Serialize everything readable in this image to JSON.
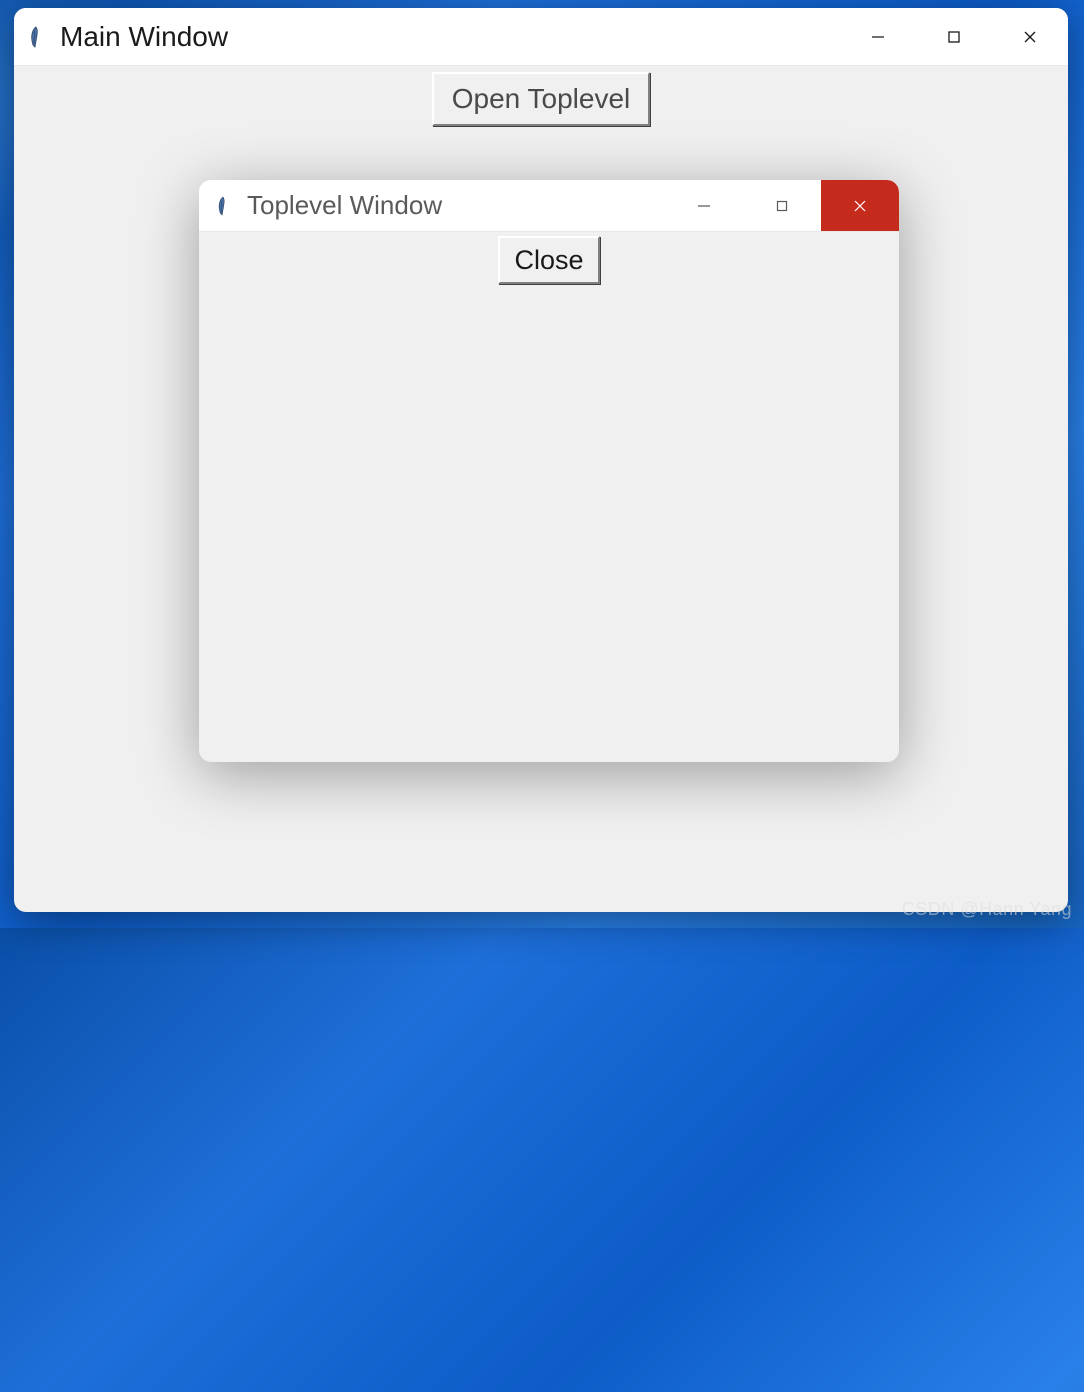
{
  "main_window": {
    "title": "Main Window",
    "open_button_label": "Open Toplevel"
  },
  "toplevel_window": {
    "title": "Toplevel Window",
    "close_button_label": "Close"
  },
  "watermark": "CSDN @Hann Yang",
  "colors": {
    "close_active": "#c42b1c",
    "window_bg": "#f0f0f0",
    "titlebar_bg": "#ffffff"
  }
}
